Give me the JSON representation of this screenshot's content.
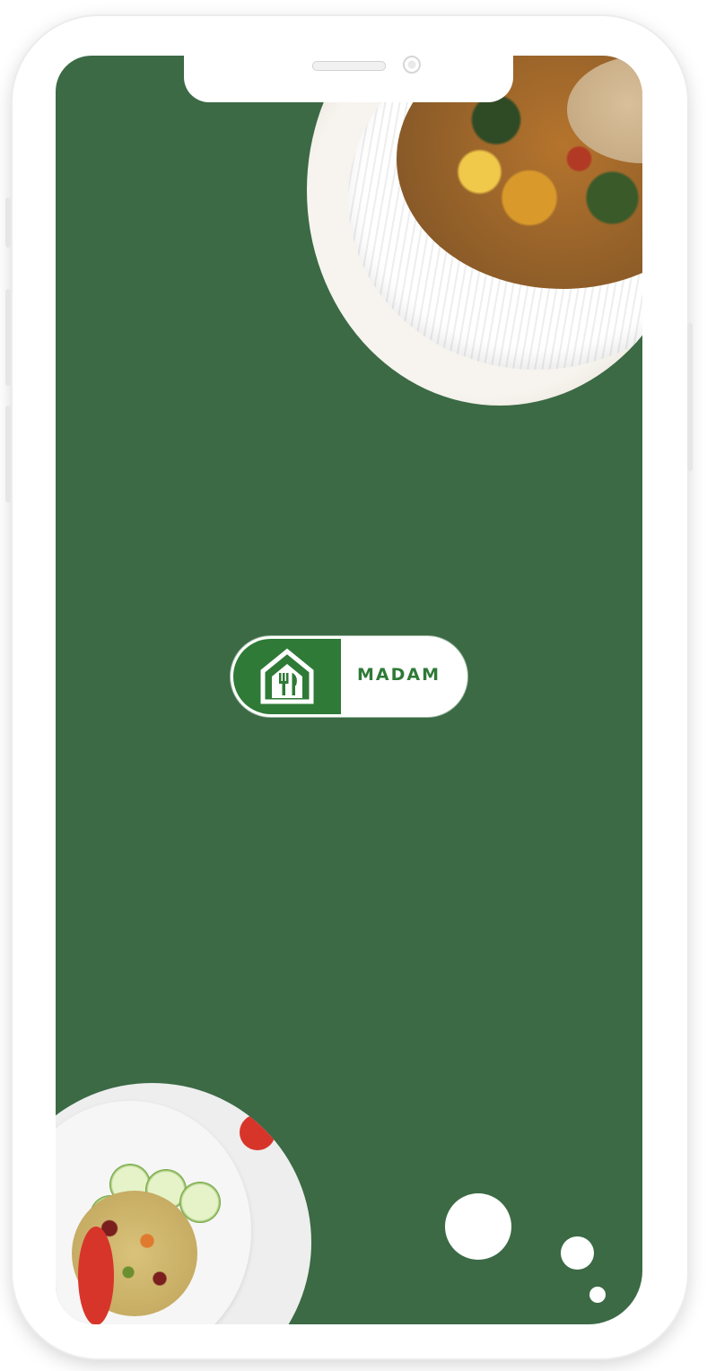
{
  "brand": {
    "name": "MADAM",
    "icon": "house-fork-knife-icon",
    "primary_color": "#2e7a36"
  },
  "theme": {
    "background_color": "#3b6a45"
  }
}
